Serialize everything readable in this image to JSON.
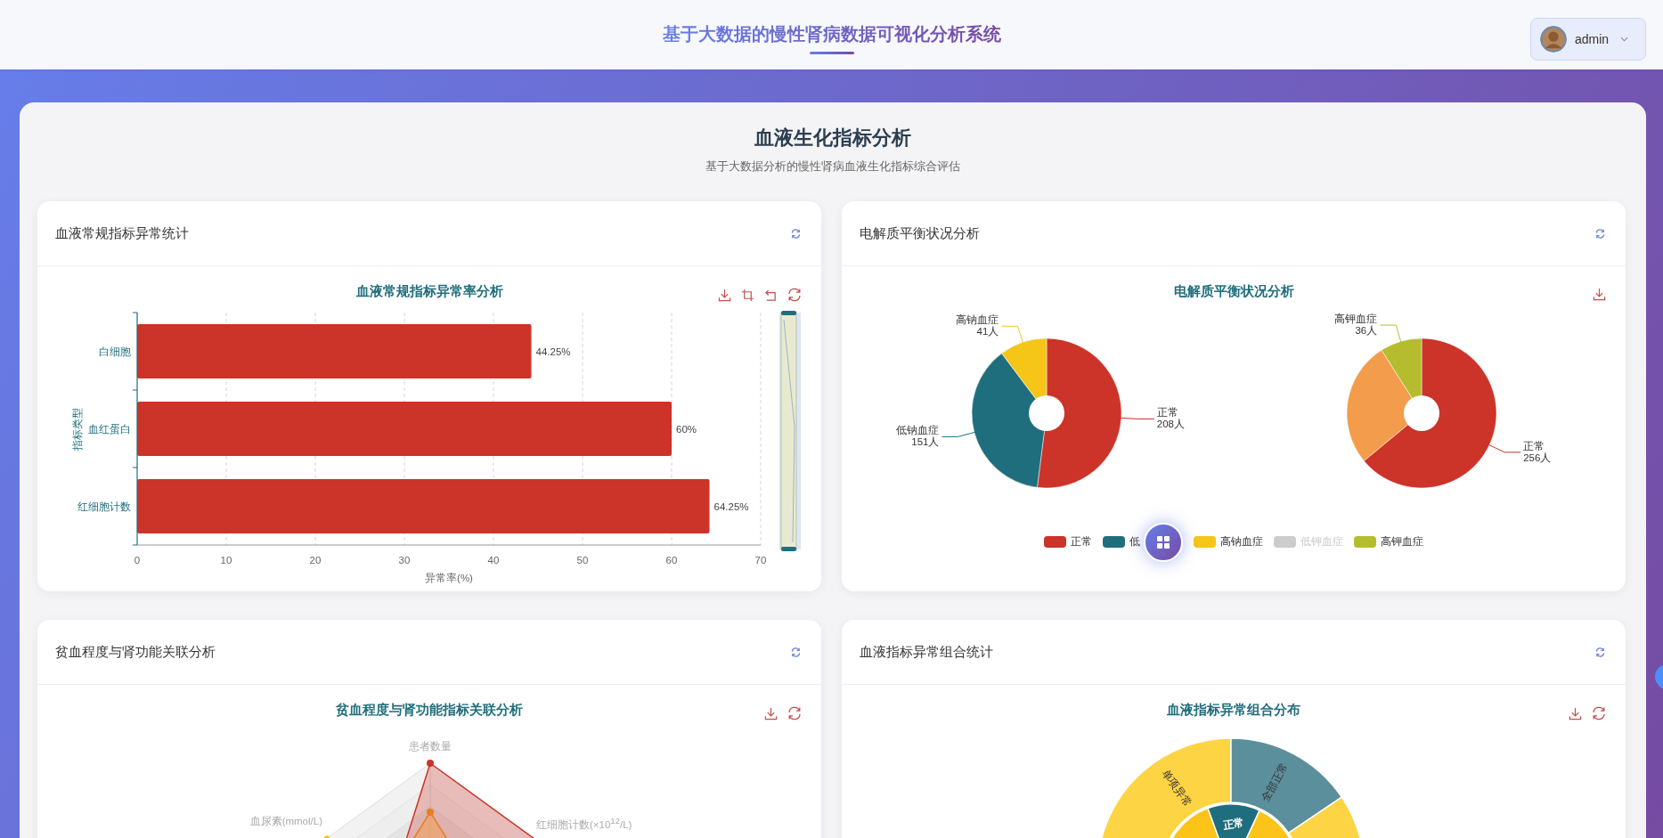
{
  "header": {
    "title": "基于大数据的慢性肾病数据可视化分析系统",
    "user": {
      "name": "admin"
    }
  },
  "page": {
    "title": "血液生化指标分析",
    "subtitle": "基于大数据分析的慢性肾病血液生化指标综合评估"
  },
  "cards": [
    {
      "kind": "bar",
      "title": "血液常规指标异常统计",
      "chart_data": {
        "type": "bar",
        "orientation": "horizontal",
        "title": "血液常规指标异常率分析",
        "xlabel": "异常率(%)",
        "ylabel": "指标类型",
        "categories": [
          "白细胞",
          "血红蛋白",
          "红细胞计数"
        ],
        "values": [
          44.25,
          60,
          64.25
        ],
        "value_labels": [
          "44.25%",
          "60%",
          "64.25%"
        ],
        "grid": true,
        "xlim": [
          0,
          70
        ],
        "xticks": [
          0,
          10,
          20,
          30,
          40,
          50,
          60,
          70
        ]
      }
    },
    {
      "kind": "pie",
      "title": "电解质平衡状况分析",
      "chart_title": "电解质平衡状况分析",
      "pies": [
        {
          "chart_data": {
            "type": "donut",
            "categories": [
              "正常",
              "低钠血症",
              "高钠血症"
            ],
            "values": [
              208,
              151,
              41
            ],
            "value_labels": [
              "208人",
              "151人",
              "41人"
            ],
            "colors": [
              "#cc3329",
              "#1f6e7d",
              "#f5c518"
            ]
          }
        },
        {
          "chart_data": {
            "type": "donut",
            "categories": [
              "正常",
              null,
              "高钾血症"
            ],
            "values": [
              256,
              108,
              36
            ],
            "value_labels": [
              "256人",
              null,
              "36人"
            ],
            "colors": [
              "#cc3329",
              "#f39c4b",
              "#b5bd2f"
            ]
          }
        }
      ],
      "legend": [
        {
          "label": "正常",
          "color": "#cc3329",
          "disabled": false
        },
        {
          "label": "低",
          "color": "#1f6e7d",
          "disabled": false
        },
        {
          "label": "高钠血症",
          "color": "#f5c518",
          "disabled": false
        },
        {
          "label": "低钾血症",
          "disabled": true
        },
        {
          "label": "高钾血症",
          "color": "#b5bd2f",
          "disabled": false
        }
      ]
    },
    {
      "kind": "radar",
      "title": "贫血程度与肾功能关联分析",
      "chart_title": "贫血程度与肾功能指标关联分析",
      "axes": [
        "患者数量",
        "血尿素(mmol/L)",
        "红细胞计数(×10$^{12}$/L)"
      ]
    },
    {
      "kind": "sunburst",
      "title": "血液指标异常组合统计",
      "chart_title": "血液指标异常组合分布",
      "segments": [
        {
          "label": "单项异常",
          "color": "#fdd443"
        },
        {
          "label": "全部正常",
          "color": "#5b8f9b"
        }
      ],
      "center": {
        "label": "正常",
        "color": "#1f6e7d"
      }
    }
  ]
}
